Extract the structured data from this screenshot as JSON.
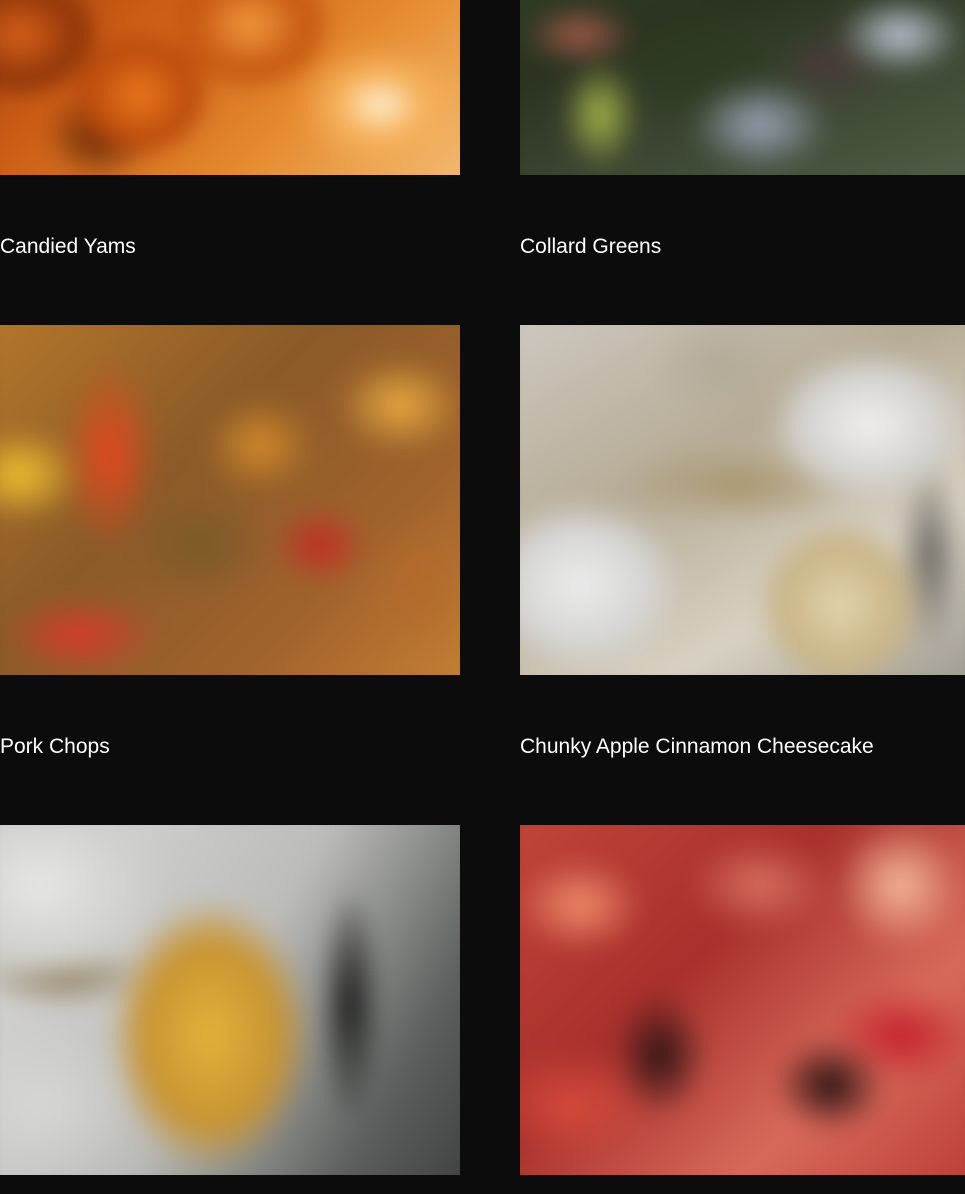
{
  "gallery": {
    "items": [
      {
        "title": "Candied Yams"
      },
      {
        "title": "Collard Greens"
      },
      {
        "title": "Pork Chops"
      },
      {
        "title": "Chunky Apple Cinnamon Cheesecake"
      }
    ]
  }
}
